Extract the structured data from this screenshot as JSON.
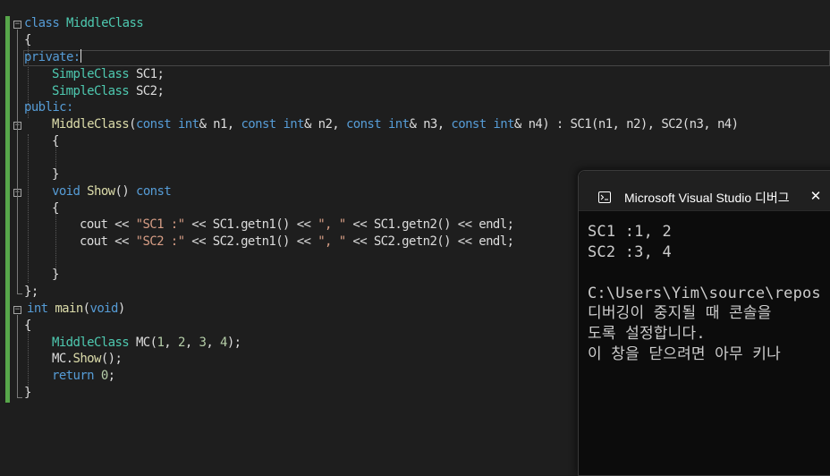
{
  "editor": {
    "code": {
      "l1": [
        "class ",
        "MiddleClass"
      ],
      "l2": "{",
      "l3": "private:",
      "l4": [
        "SimpleClass",
        " SC1;"
      ],
      "l5": [
        "SimpleClass",
        " SC2;"
      ],
      "l6": "public:",
      "l7": [
        "MiddleClass",
        "(",
        "const",
        " ",
        "int",
        "& n1, ",
        "const",
        " ",
        "int",
        "& n2, ",
        "const",
        " ",
        "int",
        "& n3, ",
        "const",
        " ",
        "int",
        "& n4) : SC1(n1, n2), SC2(n3, n4)"
      ],
      "l8": "{",
      "l9": "}",
      "l10": [
        "void",
        " ",
        "Show",
        "() ",
        "const"
      ],
      "l11": "{",
      "l12": [
        "cout << ",
        "\"SC1 :\"",
        " << SC1.getn1() << ",
        "\", \"",
        " << SC1.getn2() << endl;"
      ],
      "l13": [
        "cout << ",
        "\"SC2 :\"",
        " << SC2.getn1() << ",
        "\", \"",
        " << SC2.getn2() << endl;"
      ],
      "l14": "}",
      "l15": "};",
      "l16": [
        "int",
        " ",
        "main",
        "(",
        "void",
        ")"
      ],
      "l17": "{",
      "l18": [
        "MiddleClass",
        " MC(",
        "1",
        ", ",
        "2",
        ", ",
        "3",
        ", ",
        "4",
        ");"
      ],
      "l19": [
        "MC.",
        "Show",
        "();"
      ],
      "l20": [
        "return",
        " ",
        "0",
        ";"
      ],
      "l21": "}"
    },
    "fold_symbol": "−",
    "colors": {
      "background": "#1e1e1e",
      "keyword": "#569cd6",
      "type": "#4ec9b0",
      "function": "#dcdcaa",
      "string": "#d69d85",
      "change_bar": "#57a64a"
    }
  },
  "console": {
    "title": "Microsoft Visual Studio 디버그",
    "close_icon": "close-icon",
    "app_icon": "console-app-icon",
    "lines": [
      "SC1 :1, 2",
      "SC2 :3, 4",
      "",
      "C:\\Users\\Yim\\source\\repos",
      "디버깅이 중지될 때 콘솔을",
      "도록 설정합니다.",
      "이 창을 닫으려면 아무 키나"
    ]
  }
}
